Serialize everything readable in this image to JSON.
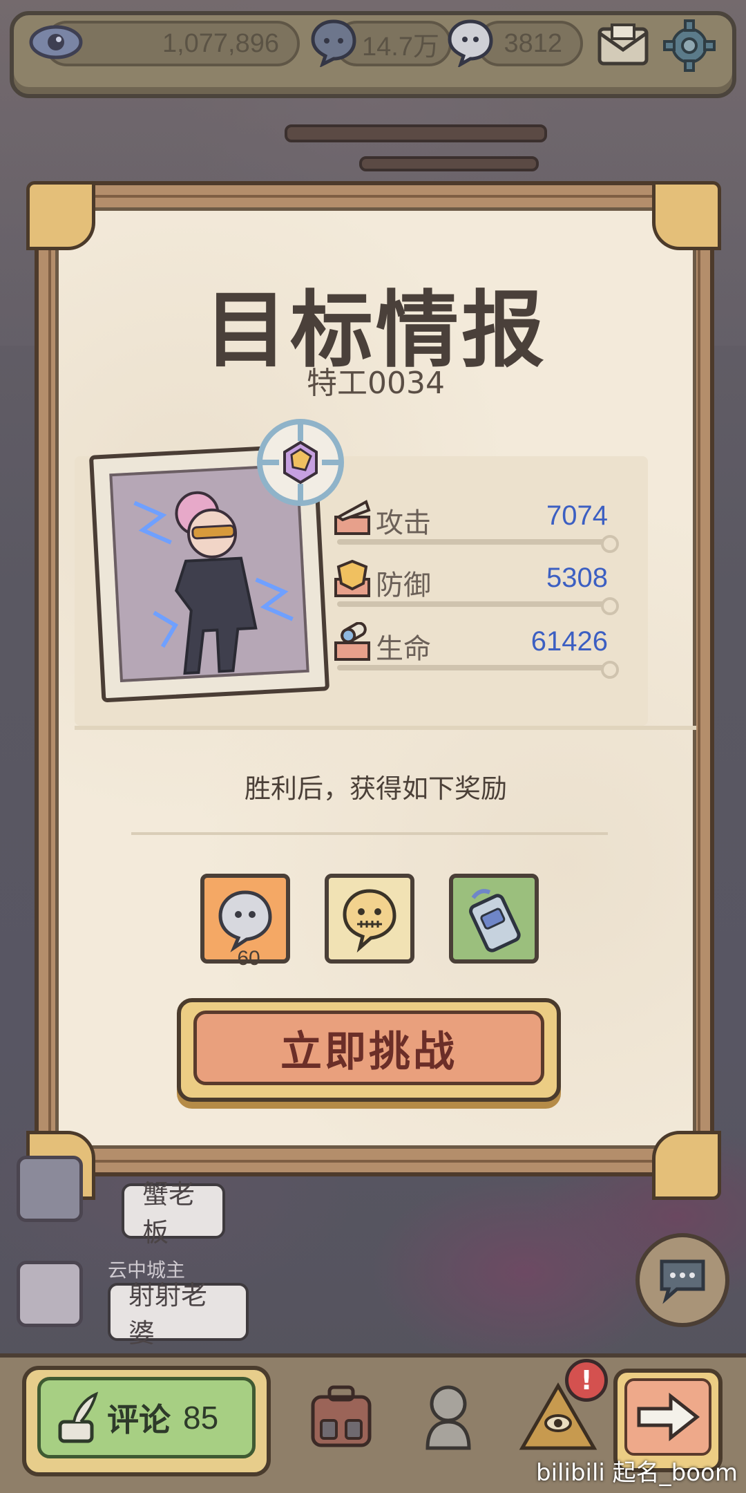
{
  "topbar": {
    "views_value": "1,077,896",
    "bubbles_value": "14.7万",
    "ghost_value": "3812",
    "icons": [
      "eye-icon",
      "speech-bubble-icon",
      "ghost-bubble-icon",
      "mail-icon",
      "gear-icon"
    ]
  },
  "card": {
    "title": "目标情报",
    "subtitle": "特工0034",
    "stats": [
      {
        "label": "攻击",
        "value": "7074",
        "icon": "attack-icon"
      },
      {
        "label": "防御",
        "value": "5308",
        "icon": "defense-icon"
      },
      {
        "label": "生命",
        "value": "61426",
        "icon": "health-icon"
      }
    ],
    "reward_title": "胜利后，获得如下奖励",
    "rewards": [
      {
        "icon": "ghost-bubble-icon",
        "count": "60",
        "bg": "#f4a865"
      },
      {
        "icon": "stitched-ghost-icon",
        "count": "",
        "bg": "#f1e2b4"
      },
      {
        "icon": "keycard-icon",
        "count": "",
        "bg": "#9bbf7d"
      }
    ],
    "challenge_label": "立即挑战"
  },
  "chat": {
    "message_1": "蟹老板",
    "sender_2": "云中城主",
    "message_2": "射射老婆"
  },
  "bottombar": {
    "comment_label": "评论",
    "comment_count": "85",
    "alert_glyph": "!"
  },
  "watermark": "bilibili 起名_boom",
  "colors": {
    "stat_value": "#3c5fc2",
    "challenge_button": "#e9a07d",
    "comment_button": "#a7cf83",
    "alert": "#d4514f"
  }
}
